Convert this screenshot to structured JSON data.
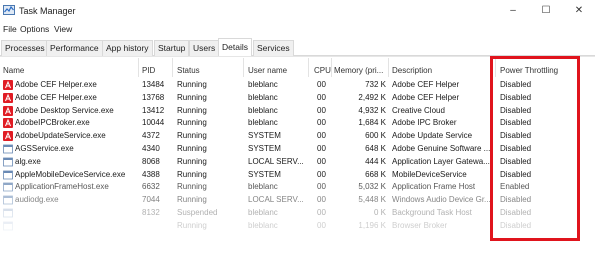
{
  "window": {
    "title": "Task Manager",
    "controls": {
      "minimize": "–",
      "maximize": "☐",
      "close": "✕"
    }
  },
  "menu": [
    "File",
    "Options",
    "View"
  ],
  "tabs": [
    "Processes",
    "Performance",
    "App history",
    "Startup",
    "Users",
    "Details",
    "Services"
  ],
  "active_tab": "Details",
  "columns": [
    "Name",
    "PID",
    "Status",
    "User name",
    "CPU",
    "Memory (pri...",
    "Description",
    "Power Throttling"
  ],
  "rows": [
    {
      "name": "Adobe CEF Helper.exe",
      "pid": "13484",
      "status": "Running",
      "user": "bleblanc",
      "cpu": "00",
      "memory": "732 K",
      "description": "Adobe CEF Helper",
      "power": "Disabled",
      "icon": "adobe-icon"
    },
    {
      "name": "Adobe CEF Helper.exe",
      "pid": "13768",
      "status": "Running",
      "user": "bleblanc",
      "cpu": "00",
      "memory": "2,492 K",
      "description": "Adobe CEF Helper",
      "power": "Disabled",
      "icon": "adobe-icon"
    },
    {
      "name": "Adobe Desktop Service.exe",
      "pid": "13412",
      "status": "Running",
      "user": "bleblanc",
      "cpu": "00",
      "memory": "4,932 K",
      "description": "Creative Cloud",
      "power": "Disabled",
      "icon": "adobe-icon"
    },
    {
      "name": "AdobeIPCBroker.exe",
      "pid": "10044",
      "status": "Running",
      "user": "bleblanc",
      "cpu": "00",
      "memory": "1,684 K",
      "description": "Adobe IPC Broker",
      "power": "Disabled",
      "icon": "adobe-icon"
    },
    {
      "name": "AdobeUpdateService.exe",
      "pid": "4372",
      "status": "Running",
      "user": "SYSTEM",
      "cpu": "00",
      "memory": "600 K",
      "description": "Adobe Update Service",
      "power": "Disabled",
      "icon": "adobe-icon"
    },
    {
      "name": "AGSService.exe",
      "pid": "4340",
      "status": "Running",
      "user": "SYSTEM",
      "cpu": "00",
      "memory": "648 K",
      "description": "Adobe Genuine Software ...",
      "power": "Disabled",
      "icon": "app-window-icon"
    },
    {
      "name": "alg.exe",
      "pid": "8068",
      "status": "Running",
      "user": "LOCAL SERV...",
      "cpu": "00",
      "memory": "444 K",
      "description": "Application Layer Gatewa...",
      "power": "Disabled",
      "icon": "app-window-icon"
    },
    {
      "name": "AppleMobileDeviceService.exe",
      "pid": "4388",
      "status": "Running",
      "user": "SYSTEM",
      "cpu": "00",
      "memory": "668 K",
      "description": "MobileDeviceService",
      "power": "Disabled",
      "icon": "app-window-icon"
    },
    {
      "name": "ApplicationFrameHost.exe",
      "pid": "6632",
      "status": "Running",
      "user": "bleblanc",
      "cpu": "00",
      "memory": "5,032 K",
      "description": "Application Frame Host",
      "power": "Enabled",
      "icon": "app-window-icon"
    },
    {
      "name": "audiodg.exe",
      "pid": "7044",
      "status": "Running",
      "user": "LOCAL SERV...",
      "cpu": "00",
      "memory": "5,448 K",
      "description": "Windows Audio Device Gr...",
      "power": "Disabled",
      "icon": "app-window-icon"
    },
    {
      "name": "",
      "pid": "8132",
      "status": "Suspended",
      "user": "bleblanc",
      "cpu": "00",
      "memory": "0 K",
      "description": "Background Task Host",
      "power": "Disabled",
      "icon": "app-window-icon"
    },
    {
      "name": "",
      "pid": "",
      "status": "Running",
      "user": "bleblanc",
      "cpu": "00",
      "memory": "1,196 K",
      "description": "Browser Broker",
      "power": "Disabled",
      "icon": "app-window-icon"
    }
  ],
  "colors": {
    "highlight": "#e0141d",
    "adobe": "#e01c24"
  }
}
